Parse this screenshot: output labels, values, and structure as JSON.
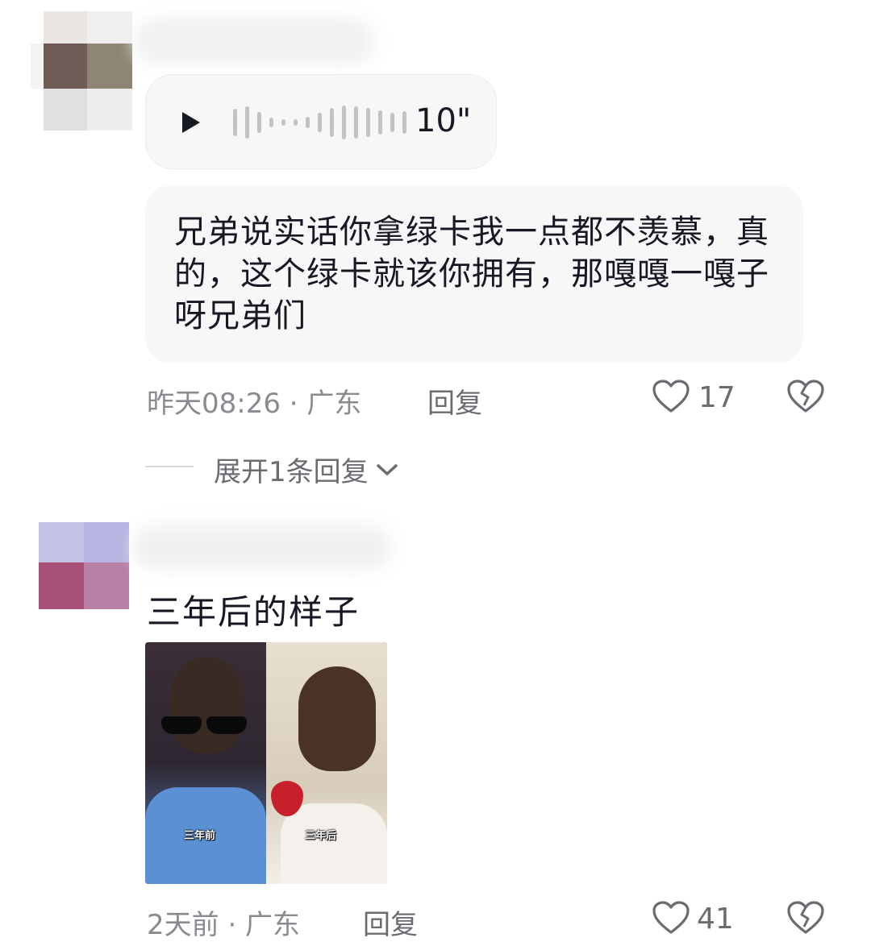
{
  "comments": [
    {
      "voice_duration": "10\"",
      "text": "兄弟说实话你拿绿卡我一点都不羡慕，真的，这个绿卡就该你拥有，那嘎嘎一嘎子呀兄弟们",
      "time_location": "昨天08:26 · 广东",
      "reply_label": "回复",
      "like_count": "17",
      "expand_label": "展开1条回复"
    },
    {
      "text": "三年后的样子",
      "image_captions": [
        "三年前",
        "三年后"
      ],
      "time_location": "2天前 · 广东",
      "reply_label": "回复",
      "like_count": "41"
    }
  ],
  "icons": {
    "play": "play-icon",
    "like": "heart-icon",
    "dislike": "broken-heart-icon",
    "expand": "chevron-down-icon"
  },
  "colors": {
    "bubble_bg": "#f7f7f8",
    "text_primary": "#161823",
    "text_secondary": "#8a8b91"
  }
}
